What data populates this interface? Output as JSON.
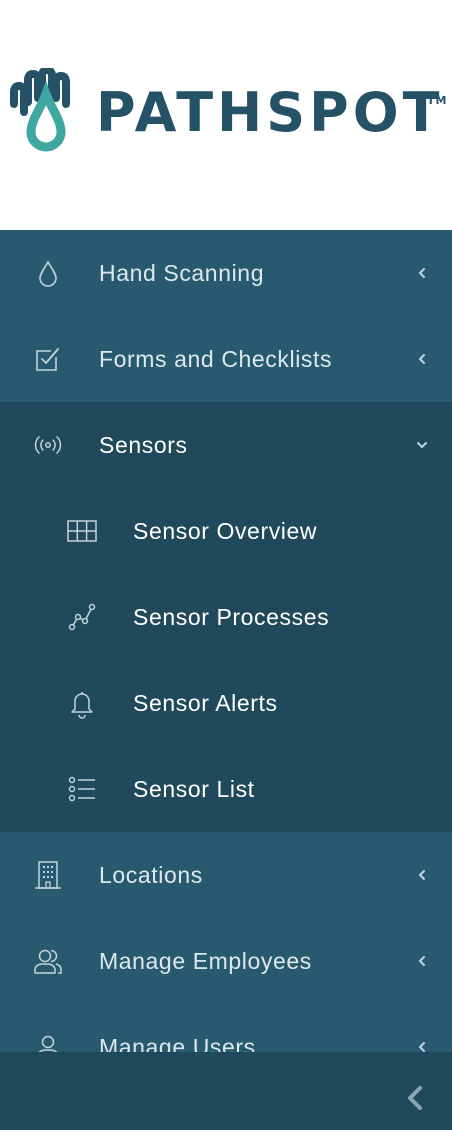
{
  "brand": {
    "name": "PATHSPOT",
    "tm": "TM",
    "colors": {
      "primary": "#255267",
      "accent": "#3da7a0"
    }
  },
  "nav": {
    "background": "#285a6f",
    "open_background": "#204a5b",
    "items": [
      {
        "label": "Hand Scanning",
        "icon": "water-drop-icon",
        "state": "collapsed"
      },
      {
        "label": "Forms and Checklists",
        "icon": "checkbox-icon",
        "state": "collapsed"
      },
      {
        "label": "Sensors",
        "icon": "broadcast-icon",
        "state": "expanded",
        "children": [
          {
            "label": "Sensor Overview",
            "icon": "grid-icon"
          },
          {
            "label": "Sensor Processes",
            "icon": "graph-nodes-icon"
          },
          {
            "label": "Sensor Alerts",
            "icon": "bell-icon"
          },
          {
            "label": "Sensor List",
            "icon": "list-icon"
          }
        ]
      },
      {
        "label": "Locations",
        "icon": "building-icon",
        "state": "collapsed"
      },
      {
        "label": "Manage Employees",
        "icon": "people-icon",
        "state": "collapsed"
      },
      {
        "label": "Manage Users",
        "icon": "person-icon",
        "state": "collapsed"
      }
    ]
  },
  "footer": {
    "collapse_icon": "chevron-left-icon"
  }
}
